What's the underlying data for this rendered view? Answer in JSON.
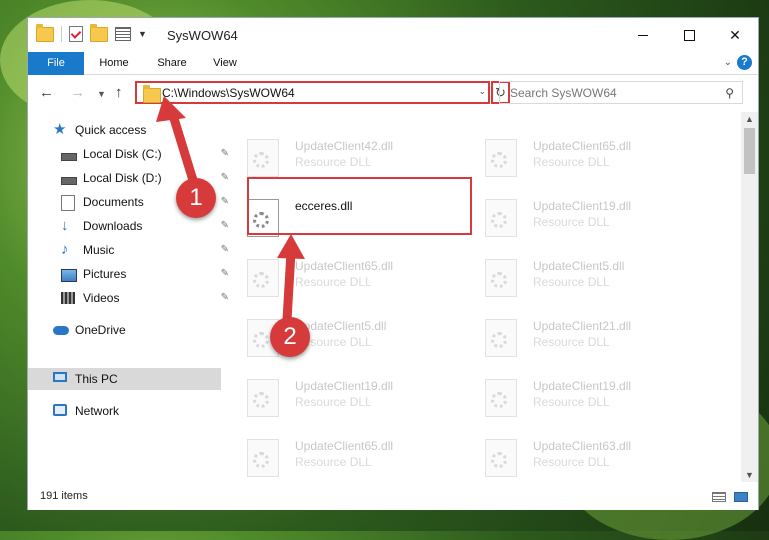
{
  "window": {
    "title": "SysWOW64",
    "ribbon_tabs": [
      "File",
      "Home",
      "Share",
      "View"
    ],
    "help_label": "?"
  },
  "address_bar": {
    "path": "C:\\Windows\\SysWOW64"
  },
  "search": {
    "placeholder": "Search SysWOW64"
  },
  "sidebar": {
    "items": [
      {
        "label": "Quick access",
        "icon": "star-icon"
      },
      {
        "label": "Local Disk (C:)",
        "icon": "drive-icon",
        "pinned": true
      },
      {
        "label": "Local Disk (D:)",
        "icon": "drive-icon",
        "pinned": true
      },
      {
        "label": "Documents",
        "icon": "documents-icon",
        "pinned": true
      },
      {
        "label": "Downloads",
        "icon": "downloads-icon",
        "pinned": true
      },
      {
        "label": "Music",
        "icon": "music-icon",
        "pinned": true
      },
      {
        "label": "Pictures",
        "icon": "pictures-icon",
        "pinned": true
      },
      {
        "label": "Videos",
        "icon": "videos-icon",
        "pinned": true
      },
      {
        "label": "OneDrive",
        "icon": "cloud-icon"
      },
      {
        "label": "This PC",
        "icon": "computer-icon",
        "selected": true
      },
      {
        "label": "Network",
        "icon": "network-icon"
      }
    ]
  },
  "files": [
    {
      "name": "UpdateClient42.dll",
      "desc": "Resource DLL"
    },
    {
      "name": "UpdateClient65.dll",
      "desc": "Resource DLL"
    },
    {
      "name": "ecceres.dll",
      "desc": ""
    },
    {
      "name": "UpdateClient19.dll",
      "desc": "Resource DLL"
    },
    {
      "name": "UpdateClient65.dll",
      "desc": "Resource DLL"
    },
    {
      "name": "UpdateClient5.dll",
      "desc": "Resource DLL"
    },
    {
      "name": "UpdateClient5.dll",
      "desc": "Resource DLL"
    },
    {
      "name": "UpdateClient21.dll",
      "desc": "Resource DLL"
    },
    {
      "name": "UpdateClient19.dll",
      "desc": "Resource DLL"
    },
    {
      "name": "UpdateClient19.dll",
      "desc": "Resource DLL"
    },
    {
      "name": "UpdateClient65.dll",
      "desc": "Resource DLL"
    },
    {
      "name": "UpdateClient63.dll",
      "desc": "Resource DLL"
    }
  ],
  "status": {
    "item_count": "191 items"
  },
  "annotations": {
    "badge1": "1",
    "badge2": "2",
    "color": "#d63a3a"
  }
}
